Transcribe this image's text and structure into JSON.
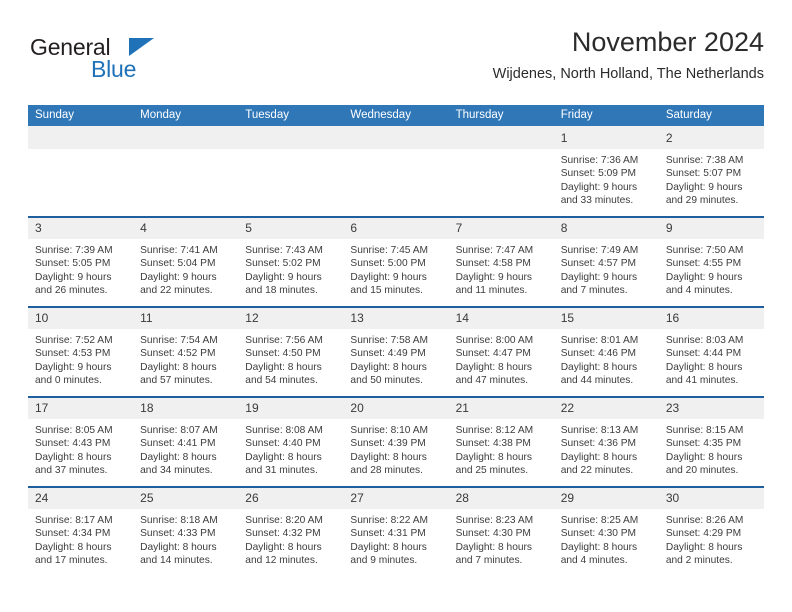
{
  "brand": {
    "name_top": "General",
    "name_bottom": "Blue",
    "triangle_icon": "blue-triangle-logo-icon",
    "accent_color": "#1f72b8"
  },
  "header": {
    "title": "November 2024",
    "subtitle": "Wijdenes, North Holland, The Netherlands"
  },
  "colors": {
    "header_row_bg": "#3077b8",
    "week_separator": "#1f5fa0",
    "daynum_bg": "#f0f0f0",
    "text": "#3d3d3d"
  },
  "calendar": {
    "weekday_headers": [
      "Sunday",
      "Monday",
      "Tuesday",
      "Wednesday",
      "Thursday",
      "Friday",
      "Saturday"
    ],
    "labels": {
      "sunrise": "Sunrise:",
      "sunset": "Sunset:",
      "daylight": "Daylight:"
    },
    "weeks": [
      [
        {
          "day": ""
        },
        {
          "day": ""
        },
        {
          "day": ""
        },
        {
          "day": ""
        },
        {
          "day": ""
        },
        {
          "day": "1",
          "sunrise": "Sunrise: 7:36 AM",
          "sunset": "Sunset: 5:09 PM",
          "daylight": "Daylight: 9 hours and 33 minutes."
        },
        {
          "day": "2",
          "sunrise": "Sunrise: 7:38 AM",
          "sunset": "Sunset: 5:07 PM",
          "daylight": "Daylight: 9 hours and 29 minutes."
        }
      ],
      [
        {
          "day": "3",
          "sunrise": "Sunrise: 7:39 AM",
          "sunset": "Sunset: 5:05 PM",
          "daylight": "Daylight: 9 hours and 26 minutes."
        },
        {
          "day": "4",
          "sunrise": "Sunrise: 7:41 AM",
          "sunset": "Sunset: 5:04 PM",
          "daylight": "Daylight: 9 hours and 22 minutes."
        },
        {
          "day": "5",
          "sunrise": "Sunrise: 7:43 AM",
          "sunset": "Sunset: 5:02 PM",
          "daylight": "Daylight: 9 hours and 18 minutes."
        },
        {
          "day": "6",
          "sunrise": "Sunrise: 7:45 AM",
          "sunset": "Sunset: 5:00 PM",
          "daylight": "Daylight: 9 hours and 15 minutes."
        },
        {
          "day": "7",
          "sunrise": "Sunrise: 7:47 AM",
          "sunset": "Sunset: 4:58 PM",
          "daylight": "Daylight: 9 hours and 11 minutes."
        },
        {
          "day": "8",
          "sunrise": "Sunrise: 7:49 AM",
          "sunset": "Sunset: 4:57 PM",
          "daylight": "Daylight: 9 hours and 7 minutes."
        },
        {
          "day": "9",
          "sunrise": "Sunrise: 7:50 AM",
          "sunset": "Sunset: 4:55 PM",
          "daylight": "Daylight: 9 hours and 4 minutes."
        }
      ],
      [
        {
          "day": "10",
          "sunrise": "Sunrise: 7:52 AM",
          "sunset": "Sunset: 4:53 PM",
          "daylight": "Daylight: 9 hours and 0 minutes."
        },
        {
          "day": "11",
          "sunrise": "Sunrise: 7:54 AM",
          "sunset": "Sunset: 4:52 PM",
          "daylight": "Daylight: 8 hours and 57 minutes."
        },
        {
          "day": "12",
          "sunrise": "Sunrise: 7:56 AM",
          "sunset": "Sunset: 4:50 PM",
          "daylight": "Daylight: 8 hours and 54 minutes."
        },
        {
          "day": "13",
          "sunrise": "Sunrise: 7:58 AM",
          "sunset": "Sunset: 4:49 PM",
          "daylight": "Daylight: 8 hours and 50 minutes."
        },
        {
          "day": "14",
          "sunrise": "Sunrise: 8:00 AM",
          "sunset": "Sunset: 4:47 PM",
          "daylight": "Daylight: 8 hours and 47 minutes."
        },
        {
          "day": "15",
          "sunrise": "Sunrise: 8:01 AM",
          "sunset": "Sunset: 4:46 PM",
          "daylight": "Daylight: 8 hours and 44 minutes."
        },
        {
          "day": "16",
          "sunrise": "Sunrise: 8:03 AM",
          "sunset": "Sunset: 4:44 PM",
          "daylight": "Daylight: 8 hours and 41 minutes."
        }
      ],
      [
        {
          "day": "17",
          "sunrise": "Sunrise: 8:05 AM",
          "sunset": "Sunset: 4:43 PM",
          "daylight": "Daylight: 8 hours and 37 minutes."
        },
        {
          "day": "18",
          "sunrise": "Sunrise: 8:07 AM",
          "sunset": "Sunset: 4:41 PM",
          "daylight": "Daylight: 8 hours and 34 minutes."
        },
        {
          "day": "19",
          "sunrise": "Sunrise: 8:08 AM",
          "sunset": "Sunset: 4:40 PM",
          "daylight": "Daylight: 8 hours and 31 minutes."
        },
        {
          "day": "20",
          "sunrise": "Sunrise: 8:10 AM",
          "sunset": "Sunset: 4:39 PM",
          "daylight": "Daylight: 8 hours and 28 minutes."
        },
        {
          "day": "21",
          "sunrise": "Sunrise: 8:12 AM",
          "sunset": "Sunset: 4:38 PM",
          "daylight": "Daylight: 8 hours and 25 minutes."
        },
        {
          "day": "22",
          "sunrise": "Sunrise: 8:13 AM",
          "sunset": "Sunset: 4:36 PM",
          "daylight": "Daylight: 8 hours and 22 minutes."
        },
        {
          "day": "23",
          "sunrise": "Sunrise: 8:15 AM",
          "sunset": "Sunset: 4:35 PM",
          "daylight": "Daylight: 8 hours and 20 minutes."
        }
      ],
      [
        {
          "day": "24",
          "sunrise": "Sunrise: 8:17 AM",
          "sunset": "Sunset: 4:34 PM",
          "daylight": "Daylight: 8 hours and 17 minutes."
        },
        {
          "day": "25",
          "sunrise": "Sunrise: 8:18 AM",
          "sunset": "Sunset: 4:33 PM",
          "daylight": "Daylight: 8 hours and 14 minutes."
        },
        {
          "day": "26",
          "sunrise": "Sunrise: 8:20 AM",
          "sunset": "Sunset: 4:32 PM",
          "daylight": "Daylight: 8 hours and 12 minutes."
        },
        {
          "day": "27",
          "sunrise": "Sunrise: 8:22 AM",
          "sunset": "Sunset: 4:31 PM",
          "daylight": "Daylight: 8 hours and 9 minutes."
        },
        {
          "day": "28",
          "sunrise": "Sunrise: 8:23 AM",
          "sunset": "Sunset: 4:30 PM",
          "daylight": "Daylight: 8 hours and 7 minutes."
        },
        {
          "day": "29",
          "sunrise": "Sunrise: 8:25 AM",
          "sunset": "Sunset: 4:30 PM",
          "daylight": "Daylight: 8 hours and 4 minutes."
        },
        {
          "day": "30",
          "sunrise": "Sunrise: 8:26 AM",
          "sunset": "Sunset: 4:29 PM",
          "daylight": "Daylight: 8 hours and 2 minutes."
        }
      ]
    ]
  }
}
